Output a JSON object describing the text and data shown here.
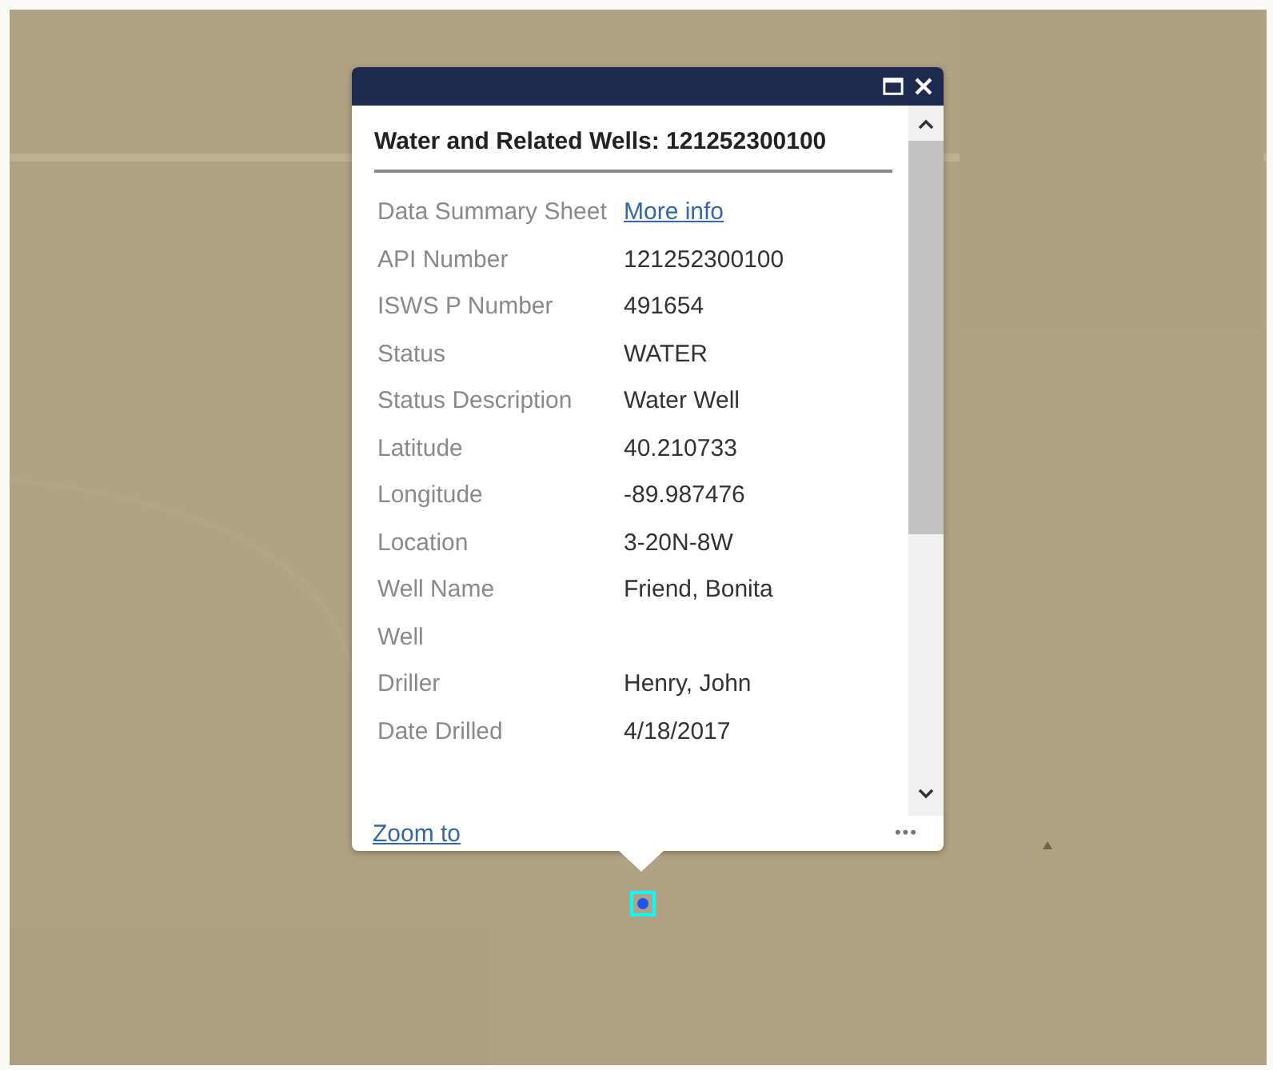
{
  "popup": {
    "title": "Water and Related Wells: 121252300100",
    "fields": [
      {
        "label": "Data Summary Sheet",
        "value": "More info",
        "kind": "link"
      },
      {
        "label": "API Number",
        "value": "121252300100",
        "kind": "text"
      },
      {
        "label": "ISWS P Number",
        "value": "491654",
        "kind": "text"
      },
      {
        "label": "Status",
        "value": "WATER",
        "kind": "text"
      },
      {
        "label": "Status Description",
        "value": "Water Well",
        "kind": "text"
      },
      {
        "label": "Latitude",
        "value": "40.210733",
        "kind": "text"
      },
      {
        "label": "Longitude",
        "value": "-89.987476",
        "kind": "text"
      },
      {
        "label": "Location",
        "value": "3-20N-8W",
        "kind": "text"
      },
      {
        "label": "Well Name",
        "value": "Friend, Bonita",
        "kind": "text"
      },
      {
        "label": "Well",
        "kind": "text"
      },
      {
        "label": "Driller",
        "value": "Henry, John",
        "kind": "text"
      },
      {
        "label": "Date Drilled",
        "value": "4/18/2017",
        "kind": "text"
      }
    ],
    "zoom_link": "Zoom to",
    "more_icon": "•••"
  }
}
